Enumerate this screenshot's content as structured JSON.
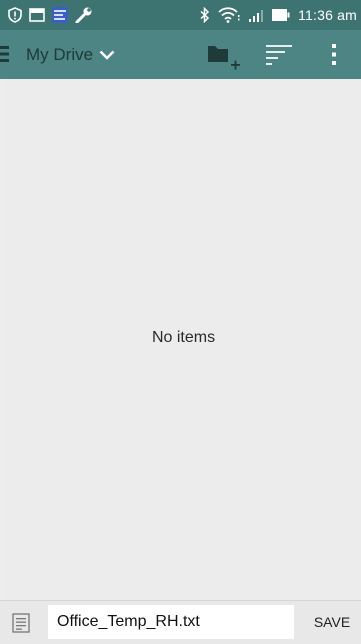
{
  "status_bar": {
    "time": "11:36 am",
    "icons": [
      "shield-alert-icon",
      "image-icon",
      "app-notification-icon",
      "wrench-icon",
      "bluetooth-icon",
      "wifi-icon",
      "signal-icon",
      "battery-icon"
    ]
  },
  "app_bar": {
    "title": "My Drive",
    "icons": [
      "menu-icon",
      "chevron-down-icon",
      "new-folder-icon",
      "sort-icon",
      "more-vert-icon"
    ],
    "color": "#4c8583"
  },
  "content": {
    "empty_message": "No items"
  },
  "bottom_bar": {
    "filename_value": "Office_Temp_RH.txt",
    "save_label": "SAVE",
    "icons": [
      "document-icon"
    ]
  }
}
